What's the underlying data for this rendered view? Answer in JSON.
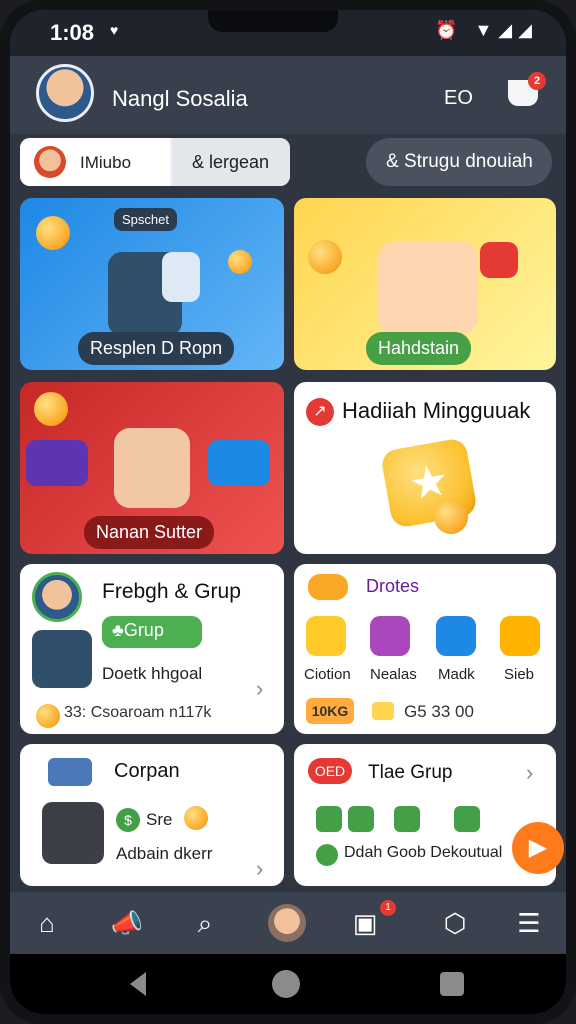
{
  "status": {
    "time": "1:08",
    "heart": "♥",
    "icons": "⏰ ▼◢◢"
  },
  "header": {
    "username": "Nangl Sosalia",
    "eo": "EO",
    "cup_badge": "2"
  },
  "tabs": [
    {
      "label": "IMiubo"
    },
    {
      "label": "& lergean"
    }
  ],
  "group_button": {
    "label": "& Strugu dnouiah"
  },
  "cards": {
    "card1": {
      "chip": "Spschet",
      "pill": "Resplen D Ropn"
    },
    "card2": {
      "pill": "Hahdstain"
    },
    "card3": {
      "pill": "Nanan Sutter"
    },
    "card4": {
      "icon": "↗",
      "title": "Hadiiah Mingguuak"
    },
    "card5": {
      "title": "Frebgh & Grup",
      "grup_pill": "♣Grup",
      "text": "Doetk hhgoal",
      "stat": "33: Csoaroam n117k"
    },
    "card6": {
      "title": "Drotes",
      "icons": [
        "Ciotion",
        "Nealas",
        "Madk",
        "Sieb"
      ],
      "badge": "10KG",
      "stat": "G5 33 00"
    },
    "card7": {
      "title": "Corpan",
      "sre": "Sre",
      "text": "Adbain dkerr"
    },
    "card8": {
      "badge": "OED",
      "title": "Tlae Grup",
      "text": "Ddah Goob Dekoutual"
    }
  },
  "bottom_nav": [
    {
      "name": "home-icon",
      "glyph": "⌂"
    },
    {
      "name": "megaphone-icon",
      "glyph": "📣"
    },
    {
      "name": "search-icon",
      "glyph": "⌕"
    },
    {
      "name": "profile-avatar",
      "glyph": ""
    },
    {
      "name": "inbox-icon",
      "glyph": "▣",
      "badge": "1"
    },
    {
      "name": "box-icon",
      "glyph": "⬡"
    },
    {
      "name": "menu-icon",
      "glyph": "☰"
    }
  ],
  "colors": {
    "accent": "#ff7a1a",
    "nav_bg": "#3a4250"
  }
}
